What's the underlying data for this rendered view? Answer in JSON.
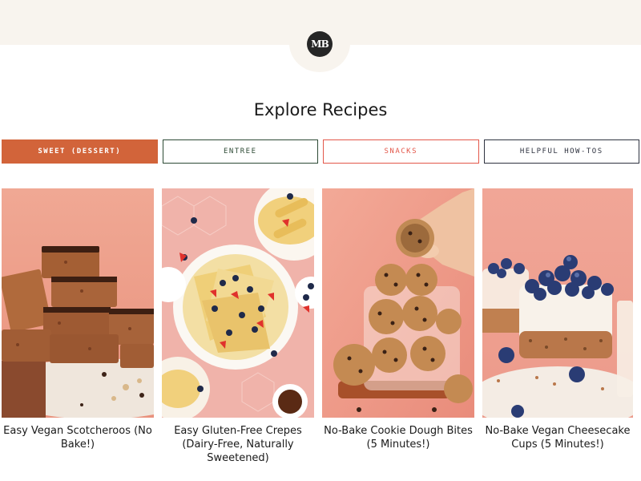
{
  "header": {
    "logo_text": "MB"
  },
  "main": {
    "title": "Explore Recipes",
    "tabs": [
      {
        "label": "Sweet (Dessert)",
        "active": true,
        "color": "#d2643a"
      },
      {
        "label": "Entree",
        "active": false,
        "color": "#2d4a35"
      },
      {
        "label": "Snacks",
        "active": false,
        "color": "#e3574a"
      },
      {
        "label": "Helpful How-Tos",
        "active": false,
        "color": "#2f3340"
      }
    ],
    "recipes": [
      {
        "title": "Easy Vegan Scotcheroos (No Bake!)",
        "image": "scotcheroos-photo"
      },
      {
        "title": "Easy Gluten-Free Crepes (Dairy-Free, Naturally Sweetened)",
        "image": "crepes-photo"
      },
      {
        "title": "No-Bake Cookie Dough Bites (5 Minutes!)",
        "image": "cookie-dough-photo"
      },
      {
        "title": "No-Bake Vegan Cheesecake Cups (5 Minutes!)",
        "image": "cheesecake-photo"
      }
    ]
  },
  "colors": {
    "background_band": "#f8f4ee",
    "accent": "#d2643a"
  }
}
